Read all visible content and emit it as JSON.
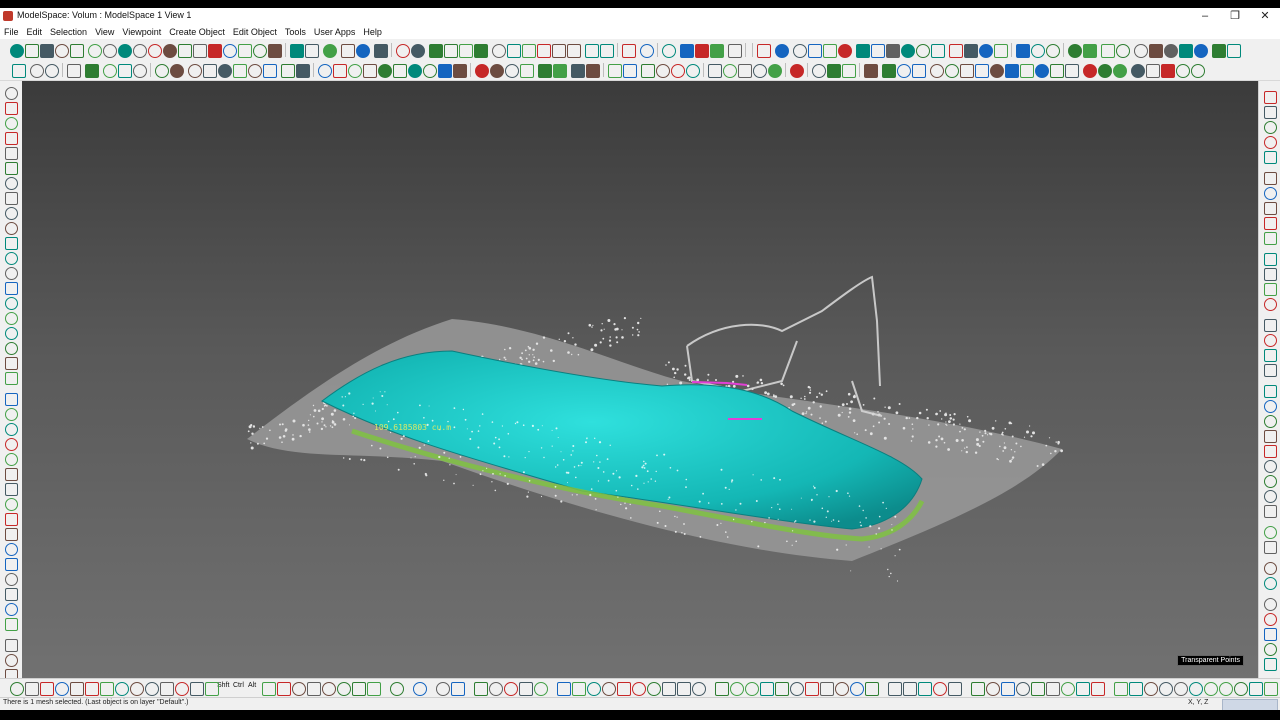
{
  "window": {
    "title": "ModelSpace: Volum : ModelSpace 1 View 1",
    "minimize_glyph": "–",
    "restore_glyph": "❐",
    "close_glyph": "✕"
  },
  "menu": {
    "items": [
      "File",
      "Edit",
      "Selection",
      "View",
      "Viewpoint",
      "Create Object",
      "Edit Object",
      "Tools",
      "User Apps",
      "Help"
    ]
  },
  "bottom_toolbar": {
    "modifier_keys": [
      "Shft",
      "Ctrl",
      "Alt"
    ]
  },
  "viewport": {
    "volume_label": "109.6185803 cu.m",
    "transparent_points_label": "Transparent Points",
    "colors": {
      "mesh": "#17c3c0",
      "mesh_dark": "#0f8f8f",
      "points": "#d8d8d8",
      "edge_green": "#7fc241",
      "polyline": "#e13fd6"
    }
  },
  "status": {
    "message": "There is 1 mesh selected. (Last object is on layer \"Default\".)",
    "coords_label": "X, Y, Z"
  }
}
